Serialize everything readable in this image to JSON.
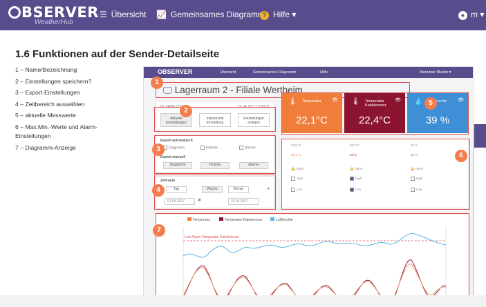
{
  "header": {
    "logo_main": "BSERVER",
    "logo_sub": "WeatherHub",
    "nav": [
      {
        "label": "Übersicht"
      },
      {
        "label": "Gemeinsames Diagramm"
      },
      {
        "label": "Hilfe ▾"
      }
    ],
    "user_label": "m ▾"
  },
  "page_title": "1.6 Funktionen auf der Sender-Detailseite",
  "steps": [
    "1 – Name/Bezeichnung",
    "2 – Einstellungen speichern?",
    "3 – Export-Einstellungen",
    "4 – Zeitbereich auswählen",
    "5 – aktuelle Messwerte",
    "6 – Max.Min.-Werte und Alarm-Einstellungen",
    "7 – Diagramm-Anzeige"
  ],
  "screenshot": {
    "logo": "OBSERVER",
    "nav": [
      "Übersicht",
      "Gemeinsames Diagramm",
      "Hilfe"
    ],
    "user": "Benutzer Muster ▾",
    "sender_title": "Lagerraum 2 - Filiale Wertheim",
    "device_id": "ID: 0A0B-1234",
    "device_date": "20.04.2017 13:08:05",
    "settings_buttons": [
      "Aktuelle Einstellungen",
      "Individuelle Einstellung",
      "Einstellungen anlegen"
    ],
    "export_auto_label": "Export automatisch",
    "export_manual_label": "Export manuell",
    "export_options": [
      "Diagramm",
      "Historie",
      "Alarme"
    ],
    "timerange_label": "Zeitraum",
    "timerange_options": [
      "Tag",
      "Woche",
      "Monat"
    ],
    "date_from": "01.04.2017",
    "date_to": "22.04.2017",
    "tiles": [
      {
        "label": "Temperatur",
        "value": "22,1°C",
        "color": "#f07d3a"
      },
      {
        "label": "Temperatur Kabelsensor",
        "value": "22,4°C",
        "color": "#8b1530"
      },
      {
        "label": "Luftfeuchte",
        "value": "39 %",
        "color": "#3e8fd6"
      }
    ],
    "mini_cols": [
      {
        "max": "22,8 °C",
        "min": "20,1 °C"
      },
      {
        "max": "30,5°C",
        "min": "20°C"
      },
      {
        "max": "52 %",
        "min": "35 %"
      }
    ],
    "alarm_label": "Alarm",
    "high_label": "High",
    "low_label": "Low",
    "legend": [
      {
        "label": "Temperatur",
        "color": "#f07d3a"
      },
      {
        "label": "Temperatur Kabelsensor",
        "color": "#8b1530"
      },
      {
        "label": "Luftfeuchte",
        "color": "#5ab4e6"
      }
    ],
    "alarm_line_label": "Low Alarm Temperatur Kabelsensor"
  },
  "badges": [
    "1",
    "2",
    "3",
    "4",
    "5",
    "6",
    "7"
  ],
  "colors": {
    "brand": "#584c8c",
    "badge": "#f47d4e",
    "frame": "#e05050"
  }
}
